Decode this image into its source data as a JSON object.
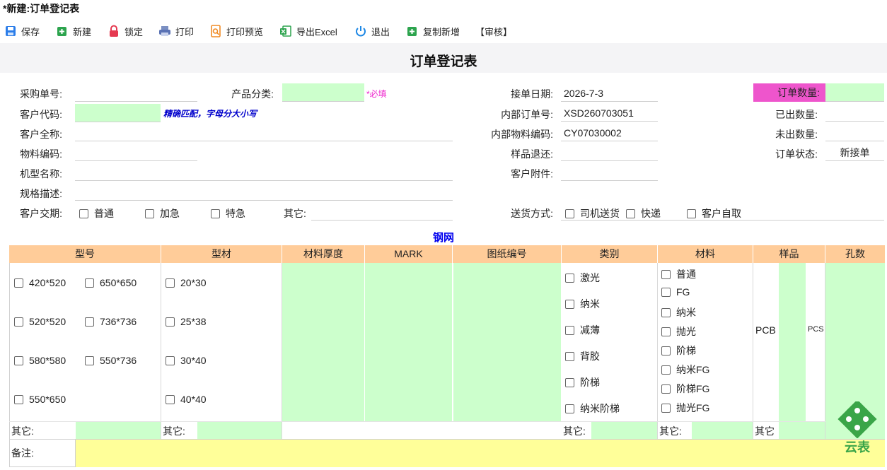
{
  "window": {
    "title": "*新建:订单登记表"
  },
  "toolbar": {
    "save": "保存",
    "new": "新建",
    "lock": "锁定",
    "print": "打印",
    "print_preview": "打印预览",
    "export_excel": "导出Excel",
    "exit": "退出",
    "copy_new": "复制新增",
    "review": "【审核】"
  },
  "form": {
    "title": "订单登记表",
    "purchase_no": {
      "label": "采购单号:",
      "value": ""
    },
    "product_category": {
      "label": "产品分类:",
      "value": "",
      "note": "*必填"
    },
    "receive_date": {
      "label": "接单日期:",
      "value": "2026-7-3"
    },
    "order_qty": {
      "label": "订单数量:",
      "value": ""
    },
    "customer_code": {
      "label": "客户代码:",
      "value": "",
      "note": "精确匹配，字母分大小写"
    },
    "internal_order_no": {
      "label": "内部订单号:",
      "value": "XSD260703051"
    },
    "shipped_qty": {
      "label": "已出数量:",
      "value": ""
    },
    "customer_fullname": {
      "label": "客户全称:",
      "value": ""
    },
    "internal_material_code": {
      "label": "内部物料编码:",
      "value": "CY07030002"
    },
    "unshipped_qty": {
      "label": "未出数量:",
      "value": ""
    },
    "material_code": {
      "label": "物料编码:",
      "value": ""
    },
    "sample_return": {
      "label": "样品退还:",
      "value": ""
    },
    "order_status": {
      "label": "订单状态:",
      "value": "新接单"
    },
    "model_name": {
      "label": "机型名称:",
      "value": ""
    },
    "customer_attachment": {
      "label": "客户附件:",
      "value": ""
    },
    "spec_desc": {
      "label": "规格描述:",
      "value": ""
    },
    "delivery_term": {
      "label": "客户交期:",
      "options": [
        "普通",
        "加急",
        "特急"
      ],
      "other_label": "其它:"
    },
    "delivery_method": {
      "label": "送货方式:",
      "options": [
        "司机送货",
        "快递",
        "客户自取"
      ]
    }
  },
  "stencil": {
    "section_title": "钢网",
    "headers": [
      "型号",
      "型材",
      "材料厚度",
      "MARK",
      "图纸编号",
      "类别",
      "材料",
      "样品",
      "孔数"
    ],
    "model_options": [
      "420*520",
      "650*650",
      "520*520",
      "736*736",
      "580*580",
      "550*736",
      "550*650"
    ],
    "profile_options": [
      "20*30",
      "25*38",
      "30*40",
      "40*40"
    ],
    "category_options": [
      "激光",
      "纳米",
      "减薄",
      "背胶",
      "阶梯",
      "纳米阶梯"
    ],
    "material_options": [
      "普通",
      "FG",
      "纳米",
      "抛光",
      "阶梯",
      "纳米FG",
      "阶梯FG",
      "抛光FG"
    ],
    "sample_label": "PCB",
    "sample_unit": "PCS",
    "other_label": "其它:",
    "other_label_sample": "其它",
    "remark_label": "备注:"
  },
  "logo": {
    "text": "云表"
  },
  "colors": {
    "green_field": "#ccffcc",
    "header_orange": "#ffcc99",
    "order_qty_magenta": "#ee55cc",
    "remark_yellow": "#ffff99",
    "section_blue": "#0000ee"
  }
}
